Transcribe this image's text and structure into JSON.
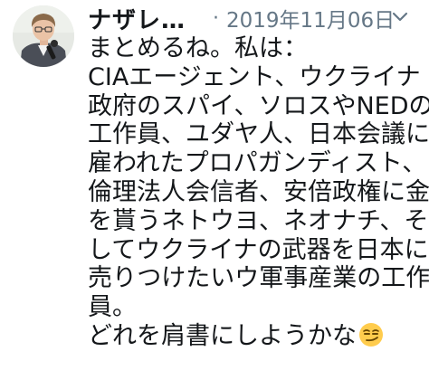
{
  "tweet": {
    "author_name": "ナザレ…",
    "separator": "·",
    "date": "2019年11月06日",
    "body_lines": [
      "まとめるね。私は：",
      "CIAエージェント、ウクライナ",
      "政府のスパイ、ソロスやNEDの",
      "工作員、ユダヤ人、日本会議に",
      "雇われたプロパガンディスト、",
      "倫理法人会信者、安倍政権に金",
      "を貰うネトウヨ、ネオナチ、そ",
      "してウクライナの武器を日本に",
      "売りつけたいウ軍事産業の工作",
      "員。",
      "どれを肩書にしようかな"
    ],
    "trailing_emoji": "smirking-face-emoji",
    "avatar_icon": "user-avatar-photo",
    "menu_icon": "chevron-down-icon",
    "colors": {
      "text": "#14171a",
      "secondary": "#657786"
    }
  }
}
